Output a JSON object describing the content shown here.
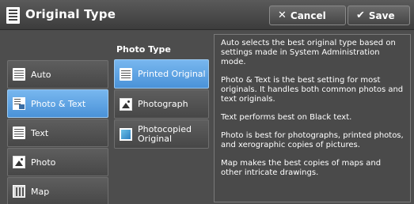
{
  "header": {
    "title": "Original Type",
    "cancel_label": "Cancel",
    "save_label": "Save",
    "cancel_icon": "close-icon",
    "save_icon": "checkmark-icon"
  },
  "original_types": [
    {
      "label": "Auto",
      "icon": "auto-doc-icon",
      "selected": false
    },
    {
      "label": "Photo & Text",
      "icon": "photo-text-icon",
      "selected": true
    },
    {
      "label": "Text",
      "icon": "text-doc-icon",
      "selected": false
    },
    {
      "label": "Photo",
      "icon": "photo-icon",
      "selected": false
    },
    {
      "label": "Map",
      "icon": "map-icon",
      "selected": false
    }
  ],
  "photo_type": {
    "heading": "Photo Type",
    "options": [
      {
        "label": "Printed Original",
        "icon": "printed-original-icon",
        "selected": true
      },
      {
        "label": "Photograph",
        "icon": "photograph-icon",
        "selected": false
      },
      {
        "label": "Photocopied Original",
        "icon": "photocopied-original-icon",
        "selected": false
      }
    ]
  },
  "description": {
    "paragraphs": [
      "Auto selects the best original type based on settings made in System Administration mode.",
      "Photo & Text is the best setting for most originals.  It handles both common photos and text originals.",
      "Text performs best on Black text.",
      "Photo is best for photographs, printed photos, and xerographic copies of pictures.",
      "Map makes the best copies of maps and other intricate drawings."
    ]
  },
  "colors": {
    "selected": "#5aa2e0",
    "background": "#4d4d4d"
  }
}
